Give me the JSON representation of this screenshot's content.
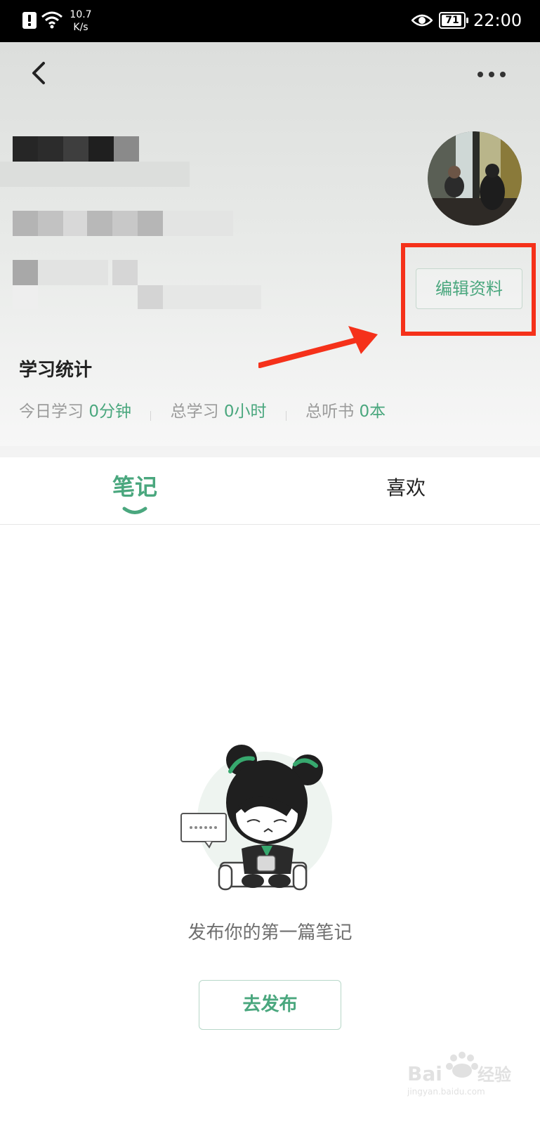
{
  "status_bar": {
    "net_speed": "10.7",
    "net_speed_unit": "K/s",
    "battery": "71",
    "time": "22:00"
  },
  "header": {
    "back_icon": "chevron-left-icon",
    "more_icon": "more-horizontal-icon",
    "edit_profile_label": "编辑资料"
  },
  "stats": {
    "title": "学习统计",
    "today_label": "今日学习",
    "today_value": "0分钟",
    "total_label": "总学习",
    "total_value": "0小时",
    "listened_label": "总听书",
    "listened_value": "0本"
  },
  "tabs": [
    {
      "label": "笔记",
      "active": true
    },
    {
      "label": "喜欢",
      "active": false
    }
  ],
  "empty_state": {
    "message": "发布你的第一篇笔记",
    "button_label": "去发布"
  },
  "watermark": {
    "text": "Baidu经验",
    "subtext": "jingyan.baidu.com"
  },
  "colors": {
    "accent": "#4aa77e",
    "highlight": "#f5311a"
  }
}
